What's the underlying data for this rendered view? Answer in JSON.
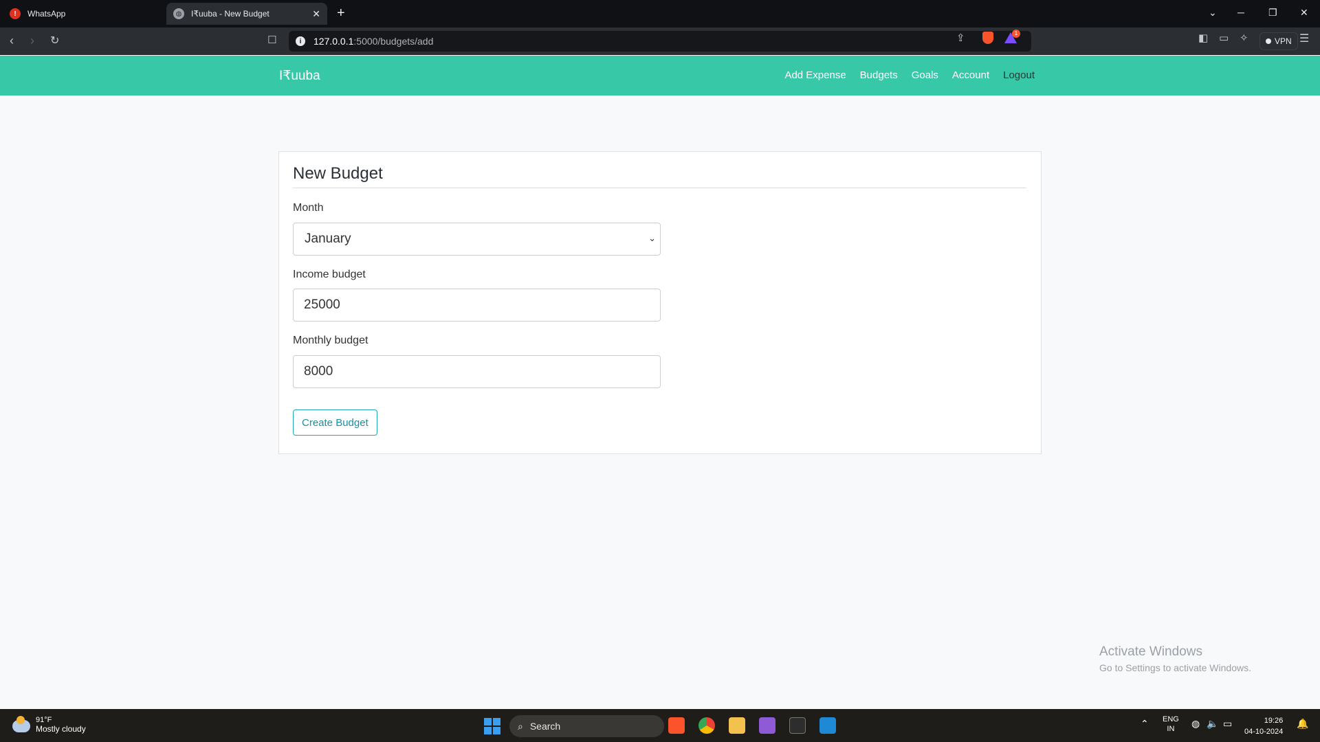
{
  "browser": {
    "tabs": [
      {
        "title": "WhatsApp",
        "active": false,
        "icon": "whatsapp-icon"
      },
      {
        "title": "I₹uuba - New Budget",
        "active": true,
        "icon": "globe-icon"
      }
    ],
    "url_host": "127.0.0.1",
    "url_path": ":5000/budgets/add",
    "vpn_label": "VPN",
    "rewards_badge": "1"
  },
  "navbar": {
    "brand": "I₹uuba",
    "links": [
      "Add Expense",
      "Budgets",
      "Goals",
      "Account",
      "Logout"
    ],
    "color": "#37c8a8"
  },
  "form": {
    "title": "New Budget",
    "month_label": "Month",
    "month_value": "January",
    "income_label": "Income budget",
    "income_value": "25000",
    "monthly_label": "Monthly budget",
    "monthly_value": "8000",
    "submit_label": "Create Budget"
  },
  "watermark": {
    "line1": "Activate Windows",
    "line2": "Go to Settings to activate Windows."
  },
  "taskbar": {
    "temp": "91°F",
    "weather": "Mostly cloudy",
    "search_placeholder": "Search",
    "lang1": "ENG",
    "lang2": "IN",
    "time": "19:26",
    "date": "04-10-2024"
  }
}
